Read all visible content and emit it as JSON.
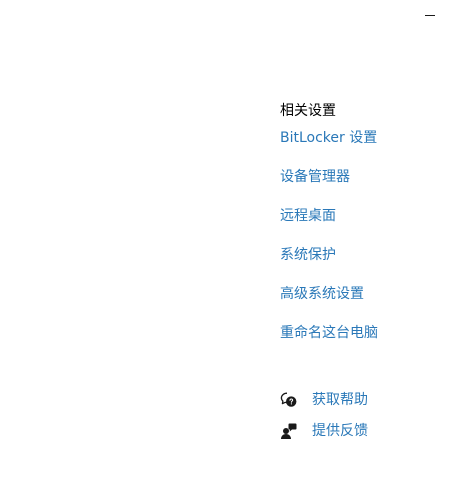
{
  "related_settings": {
    "title": "相关设置",
    "links": [
      {
        "label": "BitLocker 设置"
      },
      {
        "label": "设备管理器"
      },
      {
        "label": "远程桌面"
      },
      {
        "label": "系统保护"
      },
      {
        "label": "高级系统设置"
      },
      {
        "label": "重命名这台电脑"
      }
    ]
  },
  "help": {
    "get_help": {
      "label": "获取帮助",
      "icon": "chat-help-icon"
    },
    "feedback": {
      "label": "提供反馈",
      "icon": "feedback-icon"
    }
  },
  "colors": {
    "link": "#2a78b8",
    "text": "#000000",
    "background": "#ffffff"
  }
}
